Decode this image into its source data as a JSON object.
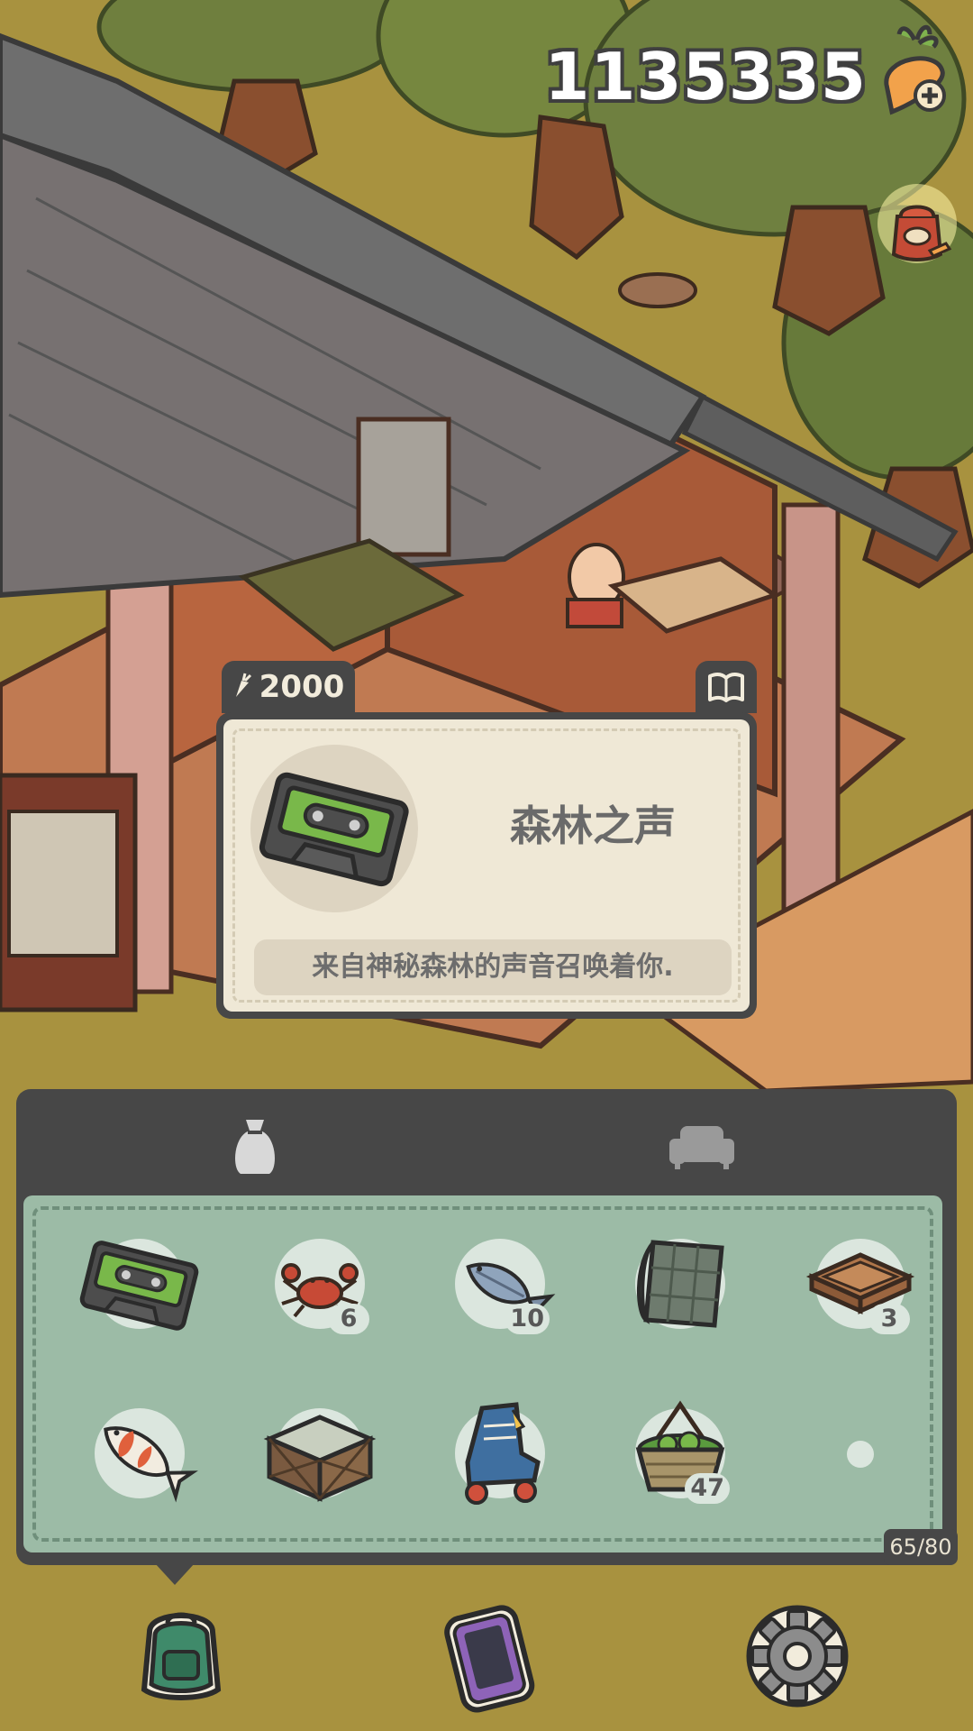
{
  "currency": {
    "amount": "1135335",
    "icon": "carrot-plus-icon"
  },
  "gift": {
    "icon": "carrot-gift-bag-icon"
  },
  "item_info": {
    "price": "2000",
    "price_icon": "carrot-icon",
    "title": "森林之声",
    "description": "来自神秘森林的声音召唤着你.",
    "icon": "cassette-tape-icon",
    "book_icon": "book-icon"
  },
  "inventory": {
    "tabs": [
      {
        "icon": "bag-icon",
        "active": true
      },
      {
        "icon": "sofa-icon",
        "active": false
      }
    ],
    "capacity": "65/80",
    "slots": [
      {
        "icon": "cassette-tape-icon",
        "count": ""
      },
      {
        "icon": "crab-icon",
        "count": "6"
      },
      {
        "icon": "fish-icon",
        "count": "10"
      },
      {
        "icon": "fabric-roll-icon",
        "count": ""
      },
      {
        "icon": "wooden-tray-icon",
        "count": "3"
      },
      {
        "icon": "koi-fish-icon",
        "count": ""
      },
      {
        "icon": "wooden-crate-icon",
        "count": ""
      },
      {
        "icon": "roller-skate-icon",
        "count": ""
      },
      {
        "icon": "vegetable-basket-icon",
        "count": "47"
      },
      {
        "icon": "empty-slot",
        "count": ""
      }
    ]
  },
  "nav": [
    {
      "icon": "backpack-icon"
    },
    {
      "icon": "phone-icon"
    },
    {
      "icon": "settings-gear-icon"
    }
  ],
  "colors": {
    "panel_dark": "#474747",
    "card_bg": "#efe8d6",
    "inventory_bg": "#9cbba6",
    "ground": "#a8923f"
  }
}
